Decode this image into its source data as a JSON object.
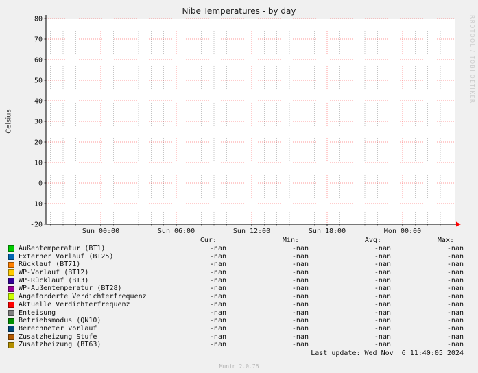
{
  "title": "Nibe Temperatures - by day",
  "y_axis_label": "Celsius",
  "watermarks": {
    "right": "RRDTOOL / TOBI OETIKER",
    "bottom": "Munin 2.0.76"
  },
  "footer": {
    "last_update": "Last update: Wed Nov  6 11:40:05 2024"
  },
  "legend": {
    "columns": [
      "Cur:",
      "Min:",
      "Avg:",
      "Max:"
    ]
  },
  "chart_data": {
    "type": "line",
    "title": "Nibe Temperatures - by day",
    "ylabel": "Celsius",
    "ylim": [
      -20,
      80
    ],
    "y_ticks": [
      80,
      70,
      60,
      50,
      40,
      30,
      20,
      10,
      0,
      -10,
      -20
    ],
    "x_tick_labels": [
      "Sun 00:00",
      "Sun 06:00",
      "Sun 12:00",
      "Sun 18:00",
      "Mon 00:00"
    ],
    "grid": true,
    "legend_position": "bottom",
    "series": [
      {
        "label": "Außentemperatur (BT1)",
        "color": "#00CC00",
        "values": [],
        "cur": "-nan",
        "min": "-nan",
        "avg": "-nan",
        "max": "-nan"
      },
      {
        "label": "Externer Vorlauf (BT25)",
        "color": "#0066B3",
        "values": [],
        "cur": "-nan",
        "min": "-nan",
        "avg": "-nan",
        "max": "-nan"
      },
      {
        "label": "Rücklauf (BT71)",
        "color": "#FF8000",
        "values": [],
        "cur": "-nan",
        "min": "-nan",
        "avg": "-nan",
        "max": "-nan"
      },
      {
        "label": "WP-Vorlauf (BT12)",
        "color": "#FFCC00",
        "values": [],
        "cur": "-nan",
        "min": "-nan",
        "avg": "-nan",
        "max": "-nan"
      },
      {
        "label": "WP-Rücklauf (BT3)",
        "color": "#330099",
        "values": [],
        "cur": "-nan",
        "min": "-nan",
        "avg": "-nan",
        "max": "-nan"
      },
      {
        "label": "WP-Außentemperatur (BT28)",
        "color": "#990099",
        "values": [],
        "cur": "-nan",
        "min": "-nan",
        "avg": "-nan",
        "max": "-nan"
      },
      {
        "label": "Angeforderte Verdichterfrequenz",
        "color": "#CCFF00",
        "values": [],
        "cur": "-nan",
        "min": "-nan",
        "avg": "-nan",
        "max": "-nan"
      },
      {
        "label": "Aktuelle Verdichterfrequenz",
        "color": "#FF0000",
        "values": [],
        "cur": "-nan",
        "min": "-nan",
        "avg": "-nan",
        "max": "-nan"
      },
      {
        "label": "Enteisung",
        "color": "#808080",
        "values": [],
        "cur": "-nan",
        "min": "-nan",
        "avg": "-nan",
        "max": "-nan"
      },
      {
        "label": "Betriebsmodus (QN10)",
        "color": "#008F00",
        "values": [],
        "cur": "-nan",
        "min": "-nan",
        "avg": "-nan",
        "max": "-nan"
      },
      {
        "label": "Berechneter Vorlauf",
        "color": "#00487D",
        "values": [],
        "cur": "-nan",
        "min": "-nan",
        "avg": "-nan",
        "max": "-nan"
      },
      {
        "label": "Zusatzheizung Stufe",
        "color": "#B35A00",
        "values": [],
        "cur": "-nan",
        "min": "-nan",
        "avg": "-nan",
        "max": "-nan"
      },
      {
        "label": "Zusatzheizung (BT63)",
        "color": "#B38F00",
        "values": [],
        "cur": "-nan",
        "min": "-nan",
        "avg": "-nan",
        "max": "-nan"
      }
    ]
  }
}
